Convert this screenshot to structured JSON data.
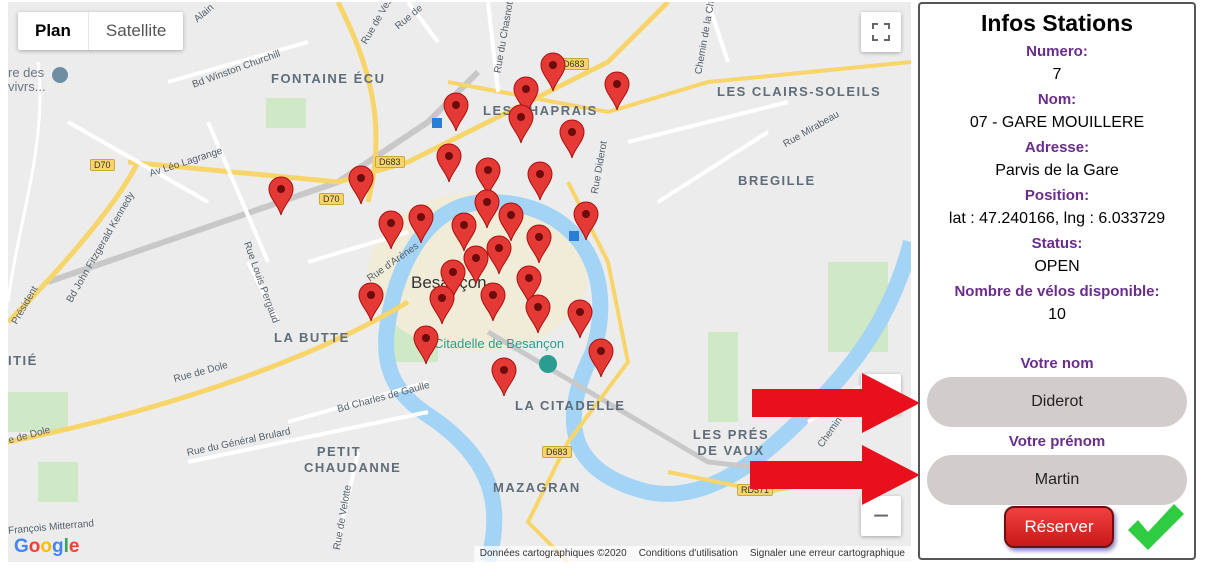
{
  "map": {
    "type_tabs": [
      "Plan",
      "Satellite"
    ],
    "google_logo": "Google",
    "footer": [
      "Données cartographiques ©2020",
      "Conditions d'utilisation",
      "Signaler une erreur cartographique"
    ],
    "districts": [
      "FONTAINE ÉCU",
      "LES CHAPRAIS",
      "LES CLAIRS-SOLEILS",
      "BREGILLE",
      "LA BUTTE",
      "LA CITADELLE",
      "PETIT CHAUDANNE",
      "LES PRÉS DE VAUX",
      "MAZAGRAN",
      "ITIÉ"
    ],
    "streets": [
      "Bd Winston Churchill",
      "Av Léo Lagrange",
      "Bd John Fitzgerald Kennedy",
      "Président",
      "Rue Louis Pergaud",
      "Rue d'Arènes",
      "Rue de Dole",
      "e de Dole",
      "Bd Charles de Gaulle",
      "Rue du Général Brulard",
      "Rue de Vesoul",
      "Rue du Chasnot",
      "Rue Mirabeau",
      "Chemin de la Ch",
      "Rue Diderot",
      "Rue de Velotte",
      "François Mitterrand",
      "Alain",
      "Rue de",
      "Chemin"
    ],
    "roads": [
      "D683",
      "D683",
      "D70",
      "D70",
      "D683",
      "RD571"
    ],
    "pois": [
      "Citadelle de Besançon",
      "Besançon",
      "re des vivrs..."
    ],
    "zoom_in": "+",
    "zoom_out": "−"
  },
  "panel": {
    "title": "Infos Stations",
    "numero_label": "Numero:",
    "numero": "7",
    "nom_label": "Nom:",
    "nom": "07 - GARE MOUILLERE",
    "adresse_label": "Adresse:",
    "adresse": "Parvis de la Gare",
    "position_label": "Position:",
    "position": "lat : 47.240166, lng : 6.033729",
    "status_label": "Status:",
    "status": "OPEN",
    "velos_label": "Nombre de vélos disponible:",
    "velos": "10",
    "votre_nom_label": "Votre nom",
    "votre_nom": "Diderot",
    "votre_prenom_label": "Votre prénom",
    "votre_prenom": "Martin",
    "reserve_button": "Réserver"
  },
  "colors": {
    "pin": "#e53935",
    "accent_label": "#6a2d8c",
    "arrow": "#e8101c",
    "check": "#2ecc40"
  }
}
